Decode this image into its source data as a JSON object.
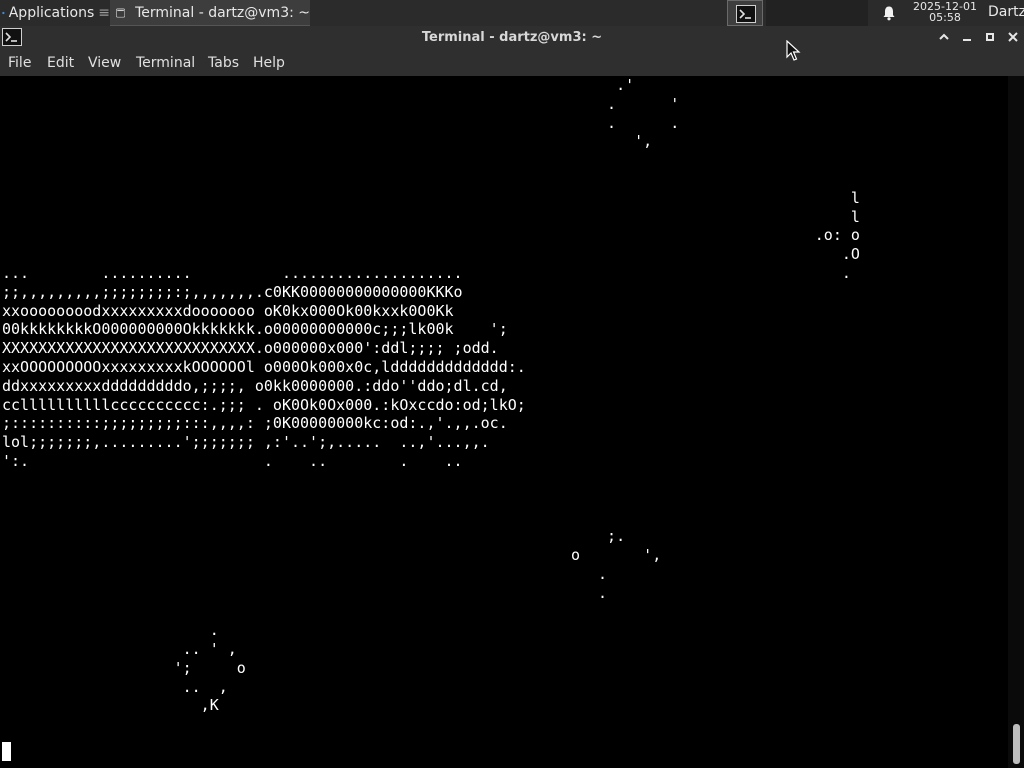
{
  "panel": {
    "applications_label": "Applications",
    "applications_separator": "≡",
    "task_label": "Terminal - dartz@vm3: ~",
    "clock_date": "2025-12-01",
    "clock_time": "05:58",
    "user_label": "Dartz",
    "icons": {
      "applications": "xfce-logo-icon",
      "task": "terminal-icon",
      "workspace": "terminal-icon",
      "notifications": "bell-icon"
    }
  },
  "window": {
    "title": "Terminal - dartz@vm3: ~",
    "icon": "terminal-icon",
    "controls": [
      "chevron-up-icon",
      "minimize-icon",
      "maximize-icon",
      "close-icon"
    ]
  },
  "menu": {
    "file": "File",
    "edit": "Edit",
    "view": "View",
    "terminal": "Terminal",
    "tabs": "Tabs",
    "help": "Help"
  },
  "terminal": {
    "lines": [
      "                                                                    .'",
      "                                                                   .      '",
      "                                                                   .      .",
      "                                                                      ',",
      "",
      "",
      "                                                                                              l",
      "                                                                                              l",
      "                                                                                          .o: o",
      "                                                                                             .O",
      "...        ..........          ....................                                          .",
      ";;,,,,,,,,,;;;;;;;;:;,,,,,,,.c0KK00000000000000KKKo",
      "xxoooooooodxxxxxxxxxdooooooo oK0kx000Ok00kxxk0O0Kk",
      "00kkkkkkkkO000000000Okkkkkkk.o00000000000c;;;lk00k    ';",
      "XXXXXXXXXXXXXXXXXXXXXXXXXXXX.o000000x000':ddl;;;; ;odd.",
      "xxOOOOOOOOOxxxxxxxxxkOOOOOOl o000Ok000x0c,lddddddddddddd:.",
      "ddxxxxxxxxxdddddddddo,;;;;, o0kk0000000.:ddo''ddo;dl.cd,",
      "ccllllllllllcccccccccc:.;;; . oK0Ok0Ox000.:kOxccdo:od;lkO;",
      ";::::::::::;;;;;;;;;:::,,,,: ;0K00000000kc:od:.,'.,,.oc.",
      "lol;;;;;;;,.........';;;;;;; ,:'..';,.....  ..,'...,,.",
      "':.                          .    ..        .    ..",
      "",
      "",
      "",
      "                                                                   ;.",
      "                                                               o       ',",
      "                                                                  .",
      "                                                                  .",
      "",
      "                       .",
      "                    .. ' ,",
      "                   ';     o",
      "                    ..  ,",
      "                      ,K"
    ],
    "colors": {
      "background": "#000000",
      "foreground": "#ffffff"
    }
  }
}
